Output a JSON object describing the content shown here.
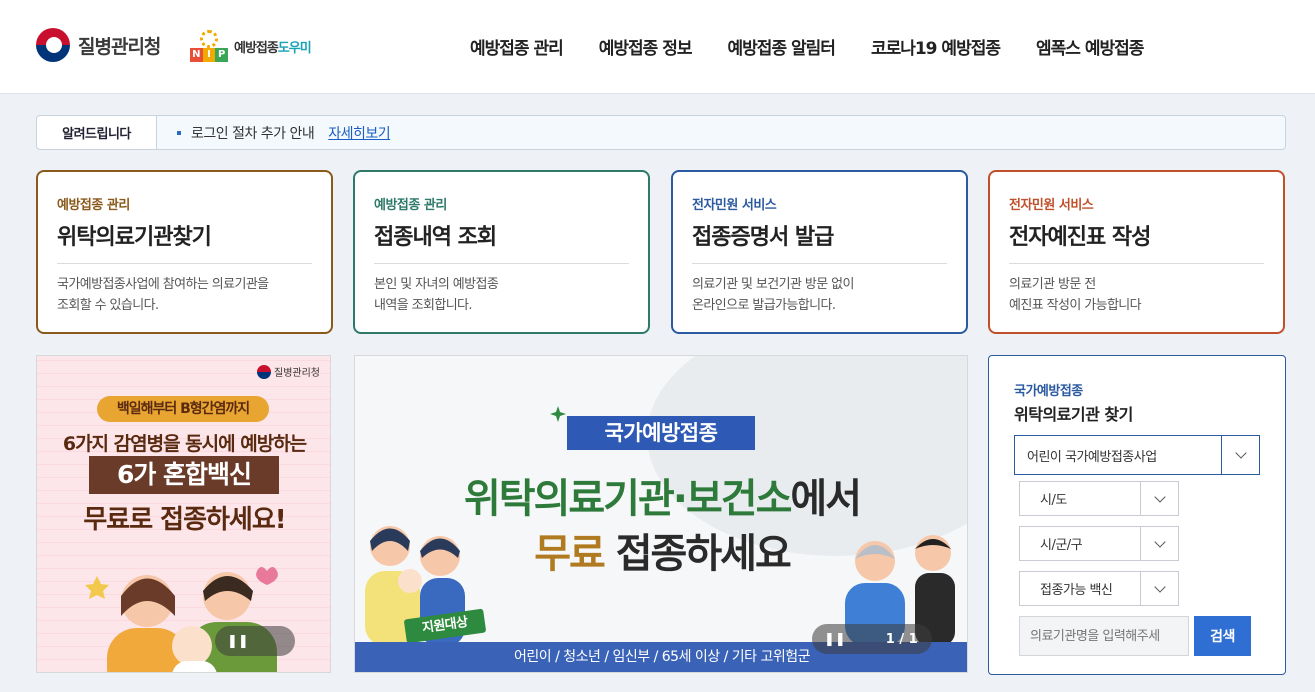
{
  "header": {
    "kdca_logo": "질병관리청",
    "nip_letters": [
      "N",
      "I",
      "P"
    ],
    "nip_logo_a": "예방접종",
    "nip_logo_b": "도우미",
    "nav": [
      "예방접종 관리",
      "예방접종 정보",
      "예방접종 알림터",
      "코로나19 예방접종",
      "엠폭스 예방접종"
    ]
  },
  "notice": {
    "title": "알려드립니다",
    "text": "로그인 절차 추가 안내",
    "link": "자세히보기"
  },
  "cards": [
    {
      "category": "예방접종 관리",
      "title": "위탁의료기관찾기",
      "desc1": "국가예방접종사업에 참여하는 의료기관을",
      "desc2": "조회할 수 있습니다.",
      "color": "#8a5a1c"
    },
    {
      "category": "예방접종 관리",
      "title": "접종내역 조회",
      "desc1": "본인 및 자녀의 예방접종",
      "desc2": "내역을 조회합니다.",
      "color": "#2e7a6a"
    },
    {
      "category": "전자민원 서비스",
      "title": "접종증명서 발급",
      "desc1": "의료기관 및 보건기관 방문 없이",
      "desc2": "온라인으로 발급가능합니다.",
      "color": "#2a5aa0"
    },
    {
      "category": "전자민원 서비스",
      "title": "전자예진표 작성",
      "desc1": "의료기관 방문 전",
      "desc2": "예진표 작성이 가능합니다",
      "color": "#c0502a"
    }
  ],
  "promo_left": {
    "logo": "질병관리청",
    "pill": "백일해부터 B형간염까지",
    "line1": "6가지 감염병을 동시에 예방하는",
    "box": "6가 혼합백신",
    "line3": "무료로 접종하세요!",
    "pause": "❚❚"
  },
  "promo_mid": {
    "tag": "국가예방접종",
    "h1_green": "위탁의료기관·보건소",
    "h1_dark": "에서",
    "h2_brown": "무료",
    "h2_dark": " 접종하세요",
    "badge": "지원대상",
    "bar": "어린이 / 청소년 / 임신부 / 65세 이상 / 기타 고위험군",
    "pause": "❚❚",
    "pager": "1 / 1"
  },
  "finder": {
    "subtitle": "국가예방접종",
    "title": "위탁의료기관 찾기",
    "program": "어린이 국가예방접종사업",
    "sido": "시/도",
    "sigungu": "시/군/구",
    "vaccine": "접종가능 백신",
    "search_placeholder": "의료기관명을 입력해주세",
    "search_button": "검색"
  }
}
